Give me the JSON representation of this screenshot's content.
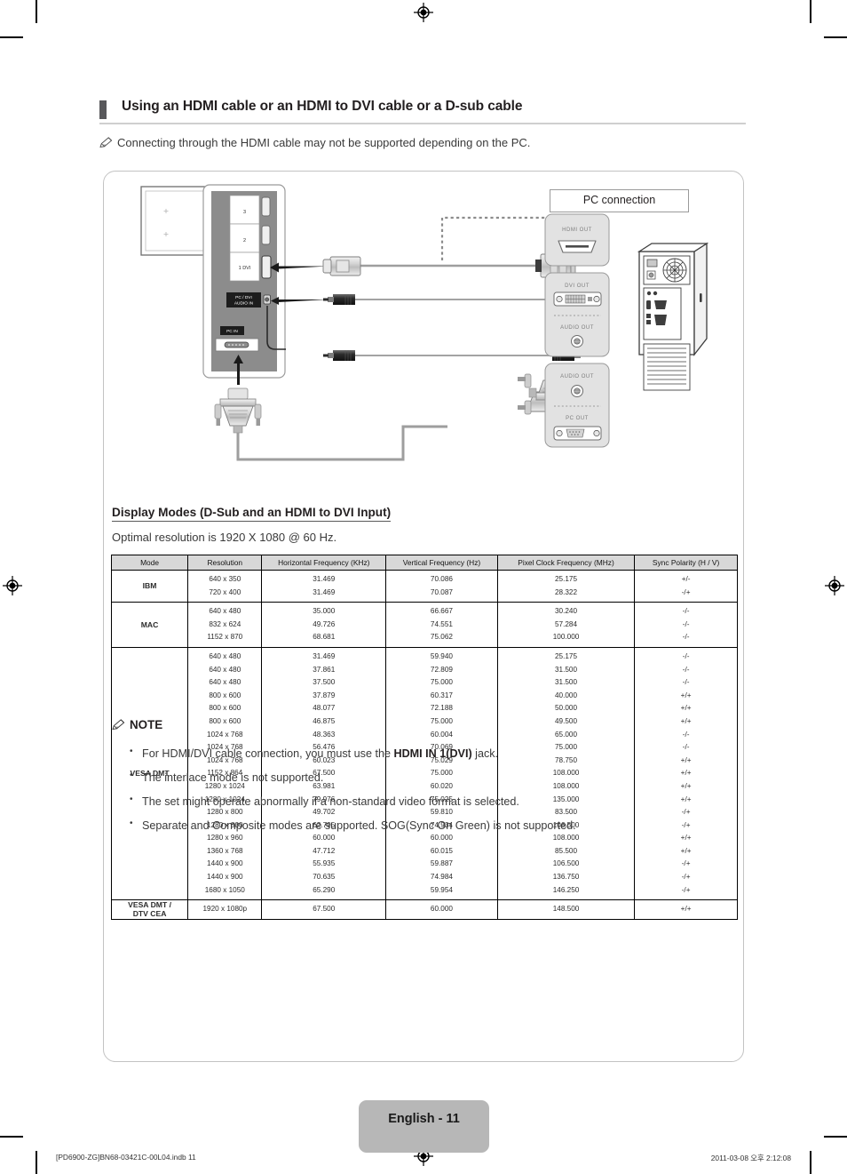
{
  "heading": {
    "title": "Using an HDMI cable or an HDMI to DVI cable or a D-sub cable"
  },
  "intro_note": {
    "icon": "pencil-icon",
    "text": "Connecting through the HDMI cable may not be supported depending on the PC."
  },
  "diagram": {
    "pc_connection_label": "PC connection",
    "tv_ports": {
      "hdmi_3": "3",
      "hdmi_2": "2",
      "hdmi_1_dvi": "1 DVI",
      "pc_dvi_audio_in_line1": "PC / DVI",
      "pc_dvi_audio_in_line2": "AUDIO IN",
      "pc_in": "PC IN"
    },
    "pc_ports": {
      "hdmi_out": "HDMI OUT",
      "dvi_out": "DVI OUT",
      "audio_out_1": "AUDIO OUT",
      "audio_out_2": "AUDIO OUT",
      "pc_out": "PC OUT"
    }
  },
  "display_modes": {
    "heading": "Display Modes (D-Sub and an HDMI to DVI Input)",
    "optimal": "Optimal resolution is 1920 X 1080 @ 60 Hz.",
    "columns": [
      "Mode",
      "Resolution",
      "Horizontal Frequency (KHz)",
      "Vertical Frequency (Hz)",
      "Pixel Clock Frequency (MHz)",
      "Sync Polarity (H / V)"
    ],
    "groups": [
      {
        "mode": "IBM",
        "rows": [
          [
            "640 x 350",
            "31.469",
            "70.086",
            "25.175",
            "+/-"
          ],
          [
            "720 x 400",
            "31.469",
            "70.087",
            "28.322",
            "-/+"
          ]
        ]
      },
      {
        "mode": "MAC",
        "rows": [
          [
            "640 x 480",
            "35.000",
            "66.667",
            "30.240",
            "-/-"
          ],
          [
            "832 x 624",
            "49.726",
            "74.551",
            "57.284",
            "-/-"
          ],
          [
            "1152 x 870",
            "68.681",
            "75.062",
            "100.000",
            "-/-"
          ]
        ]
      },
      {
        "mode": "VESA DMT",
        "rows": [
          [
            "640 x 480",
            "31.469",
            "59.940",
            "25.175",
            "-/-"
          ],
          [
            "640 x 480",
            "37.861",
            "72.809",
            "31.500",
            "-/-"
          ],
          [
            "640 x 480",
            "37.500",
            "75.000",
            "31.500",
            "-/-"
          ],
          [
            "800 x 600",
            "37.879",
            "60.317",
            "40.000",
            "+/+"
          ],
          [
            "800 x 600",
            "48.077",
            "72.188",
            "50.000",
            "+/+"
          ],
          [
            "800 x 600",
            "46.875",
            "75.000",
            "49.500",
            "+/+"
          ],
          [
            "1024 x 768",
            "48.363",
            "60.004",
            "65.000",
            "-/-"
          ],
          [
            "1024 x 768",
            "56.476",
            "70.069",
            "75.000",
            "-/-"
          ],
          [
            "1024 x 768",
            "60.023",
            "75.029",
            "78.750",
            "+/+"
          ],
          [
            "1152 x 864",
            "67.500",
            "75.000",
            "108.000",
            "+/+"
          ],
          [
            "1280 x 1024",
            "63.981",
            "60.020",
            "108.000",
            "+/+"
          ],
          [
            "1280 x 1024",
            "79.976",
            "75.025",
            "135.000",
            "+/+"
          ],
          [
            "1280 x 800",
            "49.702",
            "59.810",
            "83.500",
            "-/+"
          ],
          [
            "1280 x 800",
            "62.795",
            "74.934",
            "106.500",
            "-/+"
          ],
          [
            "1280 x 960",
            "60.000",
            "60.000",
            "108.000",
            "+/+"
          ],
          [
            "1360 x 768",
            "47.712",
            "60.015",
            "85.500",
            "+/+"
          ],
          [
            "1440 x 900",
            "55.935",
            "59.887",
            "106.500",
            "-/+"
          ],
          [
            "1440 x 900",
            "70.635",
            "74.984",
            "136.750",
            "-/+"
          ],
          [
            "1680 x 1050",
            "65.290",
            "59.954",
            "146.250",
            "-/+"
          ]
        ]
      },
      {
        "mode": "VESA DMT /\nDTV CEA",
        "mode_line1": "VESA DMT /",
        "mode_line2": "DTV CEA",
        "rows": [
          [
            "1920 x 1080p",
            "67.500",
            "60.000",
            "148.500",
            "+/+"
          ]
        ]
      }
    ]
  },
  "note": {
    "icon": "pencil-icon",
    "title": "NOTE",
    "items": [
      {
        "pre": "For HDMI/DVI cable connection, you must use the ",
        "bold": "HDMI IN 1(DVI)",
        "post": " jack."
      },
      {
        "pre": "The interlace mode is not supported.",
        "bold": "",
        "post": ""
      },
      {
        "pre": "The set might operate abnormally if a non-standard video format is selected.",
        "bold": "",
        "post": ""
      },
      {
        "pre": "Separate and Composite modes are supported. SOG(Sync On Green) is not supported.",
        "bold": "",
        "post": ""
      }
    ]
  },
  "footer": {
    "page_tab": "English - 11",
    "left": "[PD6900-ZG]BN68-03421C-00L04.indb   11",
    "right": "2011-03-08   오후 2:12:08"
  },
  "colors": {
    "heading_bar": "#58585b",
    "rule": "#cfcfcf",
    "panel_border": "#c3c3c3",
    "table_header_bg": "#d8d8d8",
    "page_tab_bg": "#b7b7b7",
    "text": "#231f20"
  }
}
